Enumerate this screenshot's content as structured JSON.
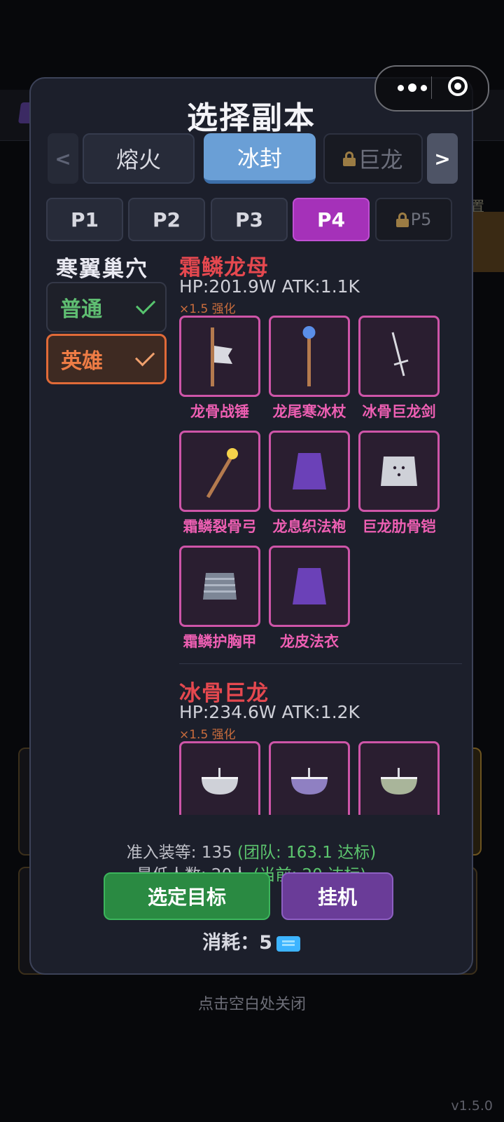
{
  "dialog": {
    "title": "选择副本",
    "dungeon_tabs": [
      {
        "label": "熔火",
        "state": "normal"
      },
      {
        "label": "冰封",
        "state": "active"
      },
      {
        "label": "巨龙",
        "state": "locked"
      }
    ],
    "nav_prev": "<",
    "nav_next": ">",
    "phase_tabs": [
      {
        "label": "P1",
        "state": "normal"
      },
      {
        "label": "P2",
        "state": "normal"
      },
      {
        "label": "P3",
        "state": "normal"
      },
      {
        "label": "P4",
        "state": "active"
      },
      {
        "label": "P5",
        "state": "locked"
      }
    ],
    "dungeon_name": "寒翼巢穴",
    "difficulties": [
      {
        "label": "普通",
        "checked": true
      },
      {
        "label": "英雄",
        "checked": true,
        "selected": true
      }
    ],
    "bosses": [
      {
        "name": "霜鳞龙母",
        "stats": "HP:201.9W  ATK:1.1K",
        "multiplier": "×1.5 强化",
        "items": [
          {
            "label": "龙骨战锤",
            "icon": "hammer-icon"
          },
          {
            "label": "龙尾寒冰杖",
            "icon": "ice-staff-icon"
          },
          {
            "label": "冰骨巨龙剑",
            "icon": "sword-icon"
          },
          {
            "label": "霜鳞裂骨弓",
            "icon": "bow-icon"
          },
          {
            "label": "龙息织法袍",
            "icon": "robe-icon"
          },
          {
            "label": "巨龙肋骨铠",
            "icon": "plate-armor-icon"
          },
          {
            "label": "霜鳞护胸甲",
            "icon": "chest-armor-icon"
          },
          {
            "label": "龙皮法衣",
            "icon": "cloth-robe-icon"
          }
        ]
      },
      {
        "name": "冰骨巨龙",
        "stats": "HP:234.6W  ATK:1.2K",
        "multiplier": "×1.5 强化",
        "items": [
          {
            "label": "",
            "icon": "helmet-icon"
          },
          {
            "label": "",
            "icon": "helmet-icon"
          },
          {
            "label": "",
            "icon": "helmet-icon"
          }
        ]
      }
    ],
    "requirements": {
      "gear_label": "准入装等: 135",
      "gear_status": "(团队: 163.1 达标)",
      "members_label": "最低人数: 20人",
      "members_status": "(当前: 20 达标)"
    },
    "select_button": "选定目标",
    "idle_button": "挂机",
    "cost_label": "消耗：5"
  },
  "background": {
    "close_hint": "点击空白处关闭",
    "version": "v1.5.0",
    "side_label": "置"
  },
  "colors": {
    "accent_blue": "#6a9fd6",
    "phase_active": "#a531b9",
    "boss_name": "#e5484f",
    "item_border": "#ce55a8",
    "status_ok": "#5cc56e",
    "hero_orange": "#ee7c45"
  }
}
